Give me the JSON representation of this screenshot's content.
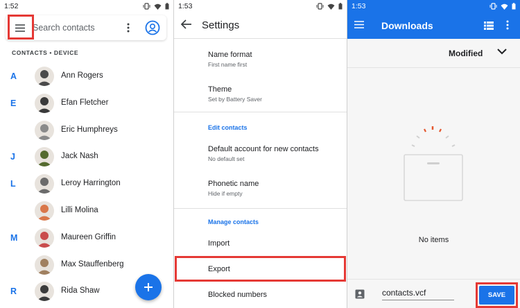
{
  "contacts_screen": {
    "status_time": "1:52",
    "search_placeholder": "Search contacts",
    "section_label": "CONTACTS • DEVICE",
    "contacts": [
      {
        "letter": "A",
        "name": "Ann Rogers",
        "avatar_color": "#4a4a4a"
      },
      {
        "letter": "E",
        "name": "Efan Fletcher",
        "avatar_color": "#3a3a3a"
      },
      {
        "letter": "",
        "name": "Eric Humphreys",
        "avatar_color": "#8a8a8a"
      },
      {
        "letter": "J",
        "name": "Jack Nash",
        "avatar_color": "#556b2f"
      },
      {
        "letter": "L",
        "name": "Leroy Harrington",
        "avatar_color": "#6b6b6b"
      },
      {
        "letter": "",
        "name": "Lilli Molina",
        "avatar_color": "#d9774a"
      },
      {
        "letter": "M",
        "name": "Maureen Griffin",
        "avatar_color": "#c94d4d"
      },
      {
        "letter": "",
        "name": "Max Stauffenberg",
        "avatar_color": "#a08060"
      },
      {
        "letter": "R",
        "name": "Rida Shaw",
        "avatar_color": "#3b3b3b"
      }
    ],
    "fab_symbol": "+"
  },
  "settings_screen": {
    "status_time": "1:53",
    "title": "Settings",
    "items": [
      {
        "title": "Name format",
        "subtitle": "First name first"
      },
      {
        "title": "Theme",
        "subtitle": "Set by Battery Saver"
      },
      {
        "header": "Edit contacts"
      },
      {
        "title": "Default account for new contacts",
        "subtitle": "No default set"
      },
      {
        "title": "Phonetic name",
        "subtitle": "Hide if empty"
      },
      {
        "header": "Manage contacts"
      },
      {
        "title": "Import"
      },
      {
        "title": "Export"
      },
      {
        "title": "Blocked numbers"
      }
    ]
  },
  "downloads_screen": {
    "status_time": "1:53",
    "title": "Downloads",
    "sort_label": "Modified",
    "empty_text": "No items",
    "filename": "contacts.vcf",
    "save_label": "SAVE"
  },
  "colors": {
    "accent": "#1a73e8",
    "highlight": "#e53935"
  }
}
